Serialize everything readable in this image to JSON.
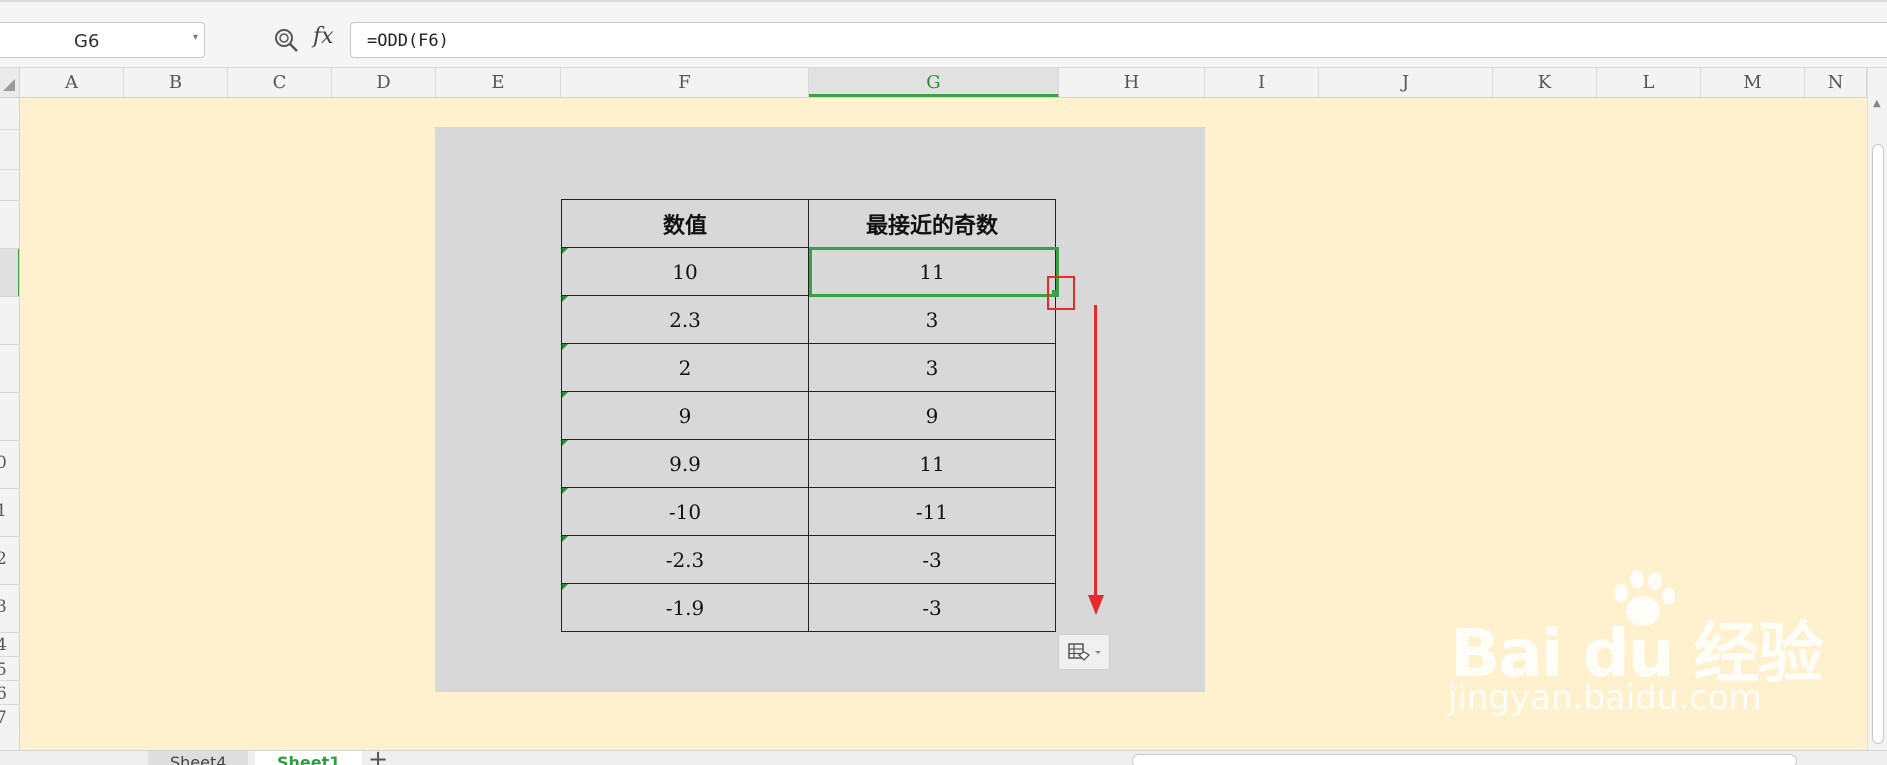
{
  "formula_bar": {
    "name_box": "G6",
    "fx_label": "fx",
    "formula": "=ODD(F6)"
  },
  "columns": [
    "A",
    "B",
    "C",
    "D",
    "E",
    "F",
    "G",
    "H",
    "I",
    "J",
    "K",
    "L",
    "M",
    "N"
  ],
  "selected_column": "G",
  "rows": {
    "visible_numbers": [
      "0",
      "1",
      "2",
      "3",
      "4",
      "5",
      "6",
      "7"
    ]
  },
  "table": {
    "headers": [
      "数值",
      "最接近的奇数"
    ],
    "rows": [
      [
        "10",
        "11"
      ],
      [
        "2.3",
        "3"
      ],
      [
        "2",
        "3"
      ],
      [
        "9",
        "9"
      ],
      [
        "9.9",
        "11"
      ],
      [
        "-10",
        "-11"
      ],
      [
        "-2.3",
        "-3"
      ],
      [
        "-1.9",
        "-3"
      ]
    ]
  },
  "sheet_tabs": [
    "Sheet4",
    "Sheet1"
  ],
  "active_sheet": "Sheet1",
  "add_sheet": "+",
  "watermark": {
    "brand": "Bai du 经验",
    "url": "jingyan.baidu.com"
  },
  "colors": {
    "grid_background": "#fff1cd",
    "panel": "#d8d8d8",
    "selection": "#3aa147",
    "annotation": "#e8282b"
  },
  "icons": [
    "zoom-icon",
    "fx-icon",
    "autofill-options-icon",
    "select-all-icon",
    "chevron-down-icon"
  ]
}
